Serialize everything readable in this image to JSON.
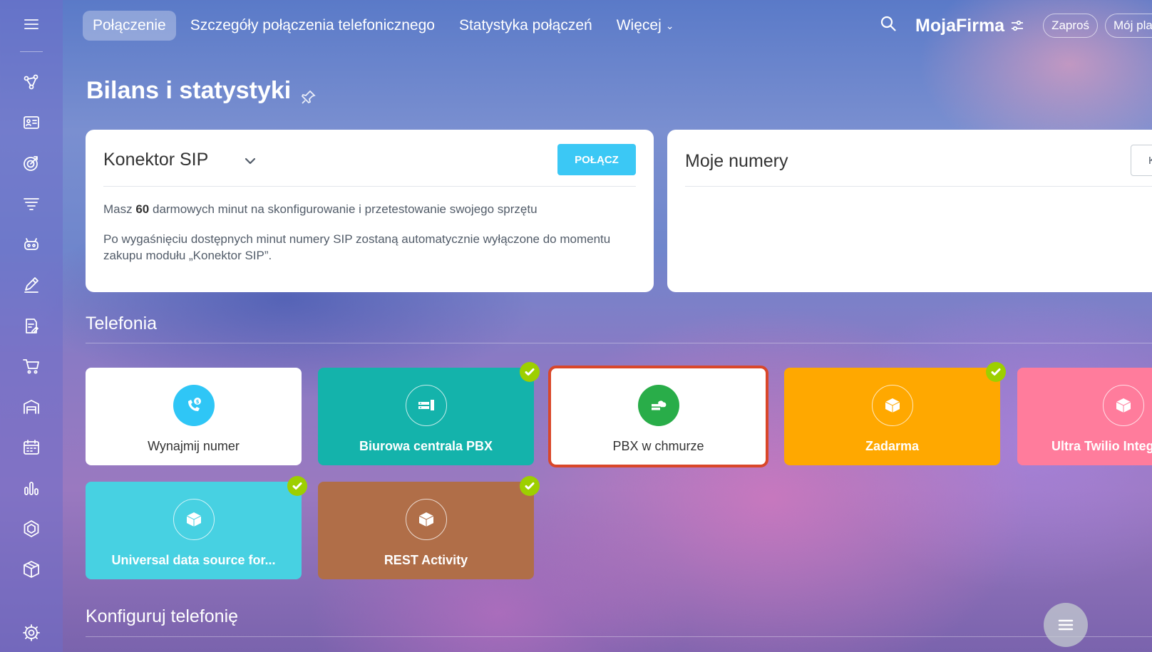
{
  "topbar": {
    "tabs": [
      {
        "label": "Połączenie",
        "active": true
      },
      {
        "label": "Szczegóły połączenia telefonicznego"
      },
      {
        "label": "Statystyka połączeń"
      },
      {
        "label": "Więcej",
        "dropdown": true
      }
    ],
    "company_name": "MojaFirma",
    "invite_label": "Zaproś",
    "plan_label": "Mój pla"
  },
  "page": {
    "title": "Bilans i statystyki"
  },
  "sip_card": {
    "title": "Konektor SIP",
    "connect_button": "POŁĄCZ",
    "minutes_prefix": "Masz ",
    "minutes_value": "60",
    "minutes_suffix": " darmowych minut na skonfigurowanie i przetestowanie swojego sprzętu",
    "notice": "Po wygaśnięciu dostępnych minut numery SIP zostaną automatycznie wyłączone do momentu zakupu modułu „Konektor SIP”."
  },
  "numbers_card": {
    "title": "Moje numery",
    "button": "KON"
  },
  "telephony": {
    "section_title": "Telefonia",
    "tiles": [
      {
        "label": "Wynajmij numer",
        "color": "#ffffff",
        "icon_bg": "#2fc6f6",
        "icon": "phone-dollar-icon",
        "checked": false,
        "selected": false
      },
      {
        "label": "Biurowa centrala PBX",
        "color": "#14b3ab",
        "icon_bg": "transparent",
        "icon": "office-pbx-icon",
        "checked": true,
        "selected": false
      },
      {
        "label": "PBX w chmurze",
        "color": "#ffffff",
        "icon_bg": "#29ad49",
        "icon": "cloud-pbx-icon",
        "checked": false,
        "selected": true
      },
      {
        "label": "Zadarma",
        "color": "#ffa800",
        "icon_bg": "transparent",
        "icon": "box-icon",
        "checked": true,
        "selected": false
      },
      {
        "label": "Ultra Twilio Integr",
        "color": "#ff7c9c",
        "icon_bg": "transparent",
        "icon": "box-icon",
        "checked": false,
        "selected": false
      },
      {
        "label": "Universal data source for...",
        "color": "#47d1e2",
        "icon_bg": "transparent",
        "icon": "box-icon",
        "checked": true,
        "selected": false
      },
      {
        "label": "REST Activity",
        "color": "#b06e48",
        "icon_bg": "transparent",
        "icon": "box-icon",
        "checked": true,
        "selected": false
      }
    ]
  },
  "configure": {
    "section_title": "Konfiguruj telefonię"
  }
}
